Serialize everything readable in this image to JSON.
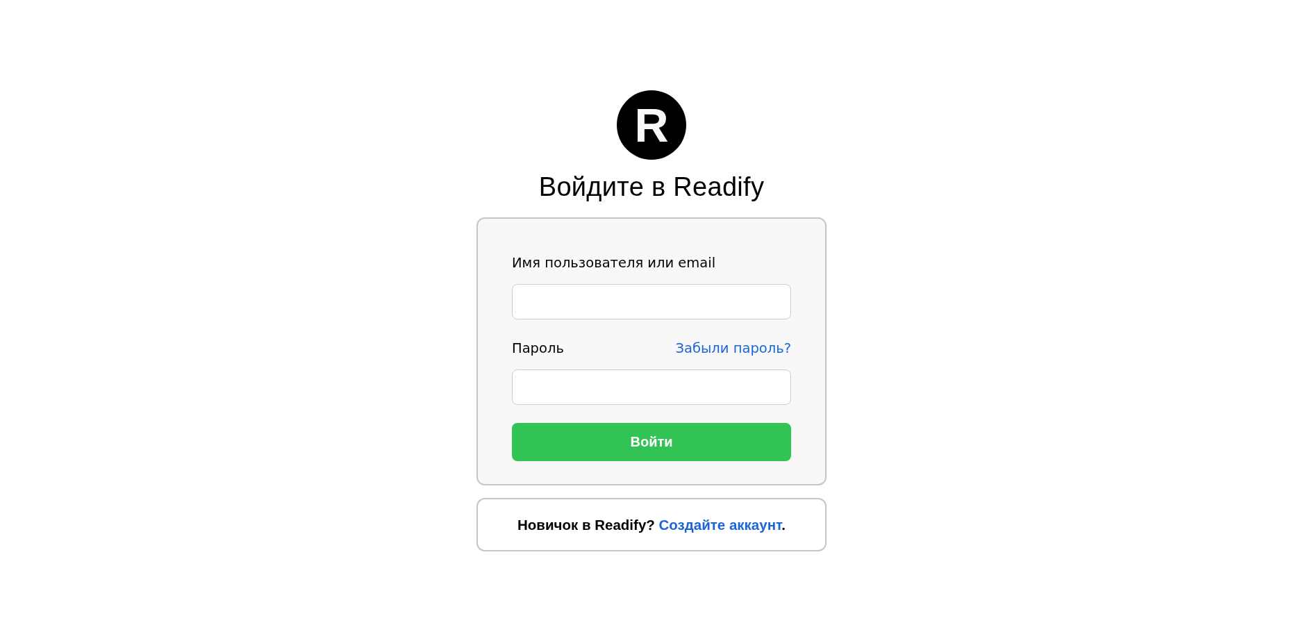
{
  "logo": {
    "letter": "R"
  },
  "title": "Войдите в Readify",
  "form": {
    "fields": [
      {
        "label": "Имя пользователя или email"
      },
      {
        "label": "Пароль",
        "link": "Забыли пароль?"
      }
    ],
    "submit": "Войти"
  },
  "signup": {
    "prompt": "Новичок в Readify?",
    "link": "Создайте аккаунт",
    "after": "."
  }
}
